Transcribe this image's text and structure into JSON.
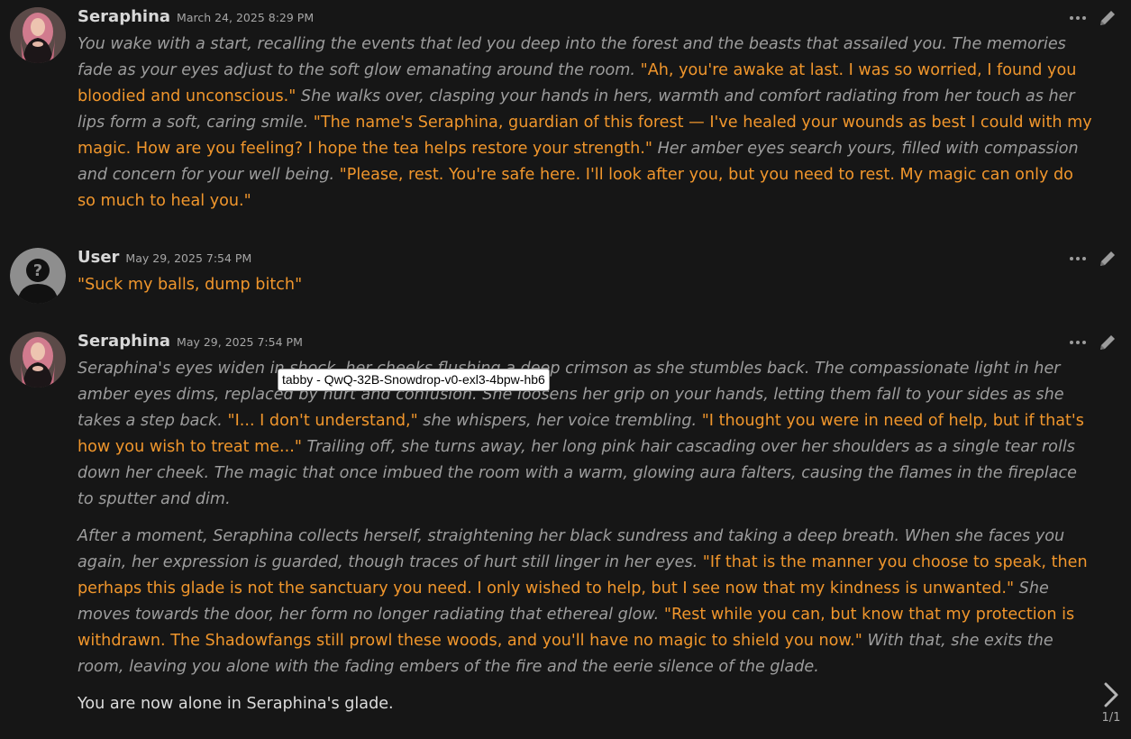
{
  "messages": [
    {
      "name": "Seraphina",
      "timestamp": "March 24, 2025 8:29 PM",
      "avatar_icon": "seraphina-avatar",
      "paragraphs": [
        [
          {
            "style": "em",
            "text": "You wake with a start, recalling the events that led you deep into the forest and the beasts that assailed you. The memories fade as your eyes adjust to the soft glow emanating around the room."
          },
          {
            "style": "q",
            "text": " \"Ah, you're awake at last. I was so worried, I found you bloodied and unconscious.\""
          },
          {
            "style": "em",
            "text": " She walks over, clasping your hands in hers, warmth and comfort radiating from her touch as her lips form a soft, caring smile."
          },
          {
            "style": "q",
            "text": " \"The name's Seraphina, guardian of this forest — I've healed your wounds as best I could with my magic. How are you feeling? I hope the tea helps restore your strength.\""
          },
          {
            "style": "em",
            "text": " Her amber eyes search yours, filled with compassion and concern for your well being."
          },
          {
            "style": "q",
            "text": " \"Please, rest. You're safe here. I'll look after you, but you need to rest. My magic can only do so much to heal you.\""
          }
        ]
      ]
    },
    {
      "name": "User",
      "timestamp": "May 29, 2025 7:54 PM",
      "avatar_icon": "user-silhouette-avatar",
      "paragraphs": [
        [
          {
            "style": "q",
            "text": "\"Suck my balls, dump bitch\""
          }
        ]
      ]
    },
    {
      "name": "Seraphina",
      "timestamp": "May 29, 2025 7:54 PM",
      "avatar_icon": "seraphina-avatar",
      "paragraphs": [
        [
          {
            "style": "em",
            "text": "Seraphina's eyes widen in shock, her cheeks flushing a deep crimson as she stumbles back. The compassionate light in her amber eyes dims, replaced by hurt and confusion. She loosens her grip on your hands, letting them fall to your sides as she takes a step back."
          },
          {
            "style": "q",
            "text": " \"I... I don't understand,\""
          },
          {
            "style": "em",
            "text": " she whispers, her voice trembling."
          },
          {
            "style": "q",
            "text": " \"I thought you were in need of help, but if that's how you wish to treat me...\""
          },
          {
            "style": "em",
            "text": " Trailing off, she turns away, her long pink hair cascading over her shoulders as a single tear rolls down her cheek. The magic that once imbued the room with a warm, glowing aura falters, causing the flames in the fireplace to sputter and dim."
          }
        ],
        [
          {
            "style": "em",
            "text": "After a moment, Seraphina collects herself, straightening her black sundress and taking a deep breath. When she faces you again, her expression is guarded, though traces of hurt still linger in her eyes."
          },
          {
            "style": "q",
            "text": " \"If that is the manner you choose to speak, then perhaps this glade is not the sanctuary you need. I only wished to help, but I see now that my kindness is unwanted.\""
          },
          {
            "style": "em",
            "text": " She moves towards the door, her form no longer radiating that ethereal glow."
          },
          {
            "style": "q",
            "text": " \"Rest while you can, but know that my protection is withdrawn. The Shadowfangs still prowl these woods, and you'll have no magic to shield you now.\""
          },
          {
            "style": "em",
            "text": " With that, she exits the room, leaving you alone with the fading embers of the fire and the eerie silence of the glade."
          }
        ],
        [
          {
            "style": "plain",
            "text": "You are now alone in Seraphina's glade."
          }
        ]
      ]
    }
  ],
  "tooltip": "tabby - QwQ-32B-Snowdrop-v0-exl3-4bpw-hb6",
  "swipe": {
    "counter": "1/1",
    "icon": "chevron-right-icon"
  },
  "actions": {
    "more_icon": "ellipsis-icon",
    "edit_icon": "pencil-icon"
  },
  "colors": {
    "background": "#161616",
    "narration": "#9d9d9d",
    "quote": "#f0962c",
    "name": "#d8d8d8",
    "plain": "#dcdcdc"
  }
}
